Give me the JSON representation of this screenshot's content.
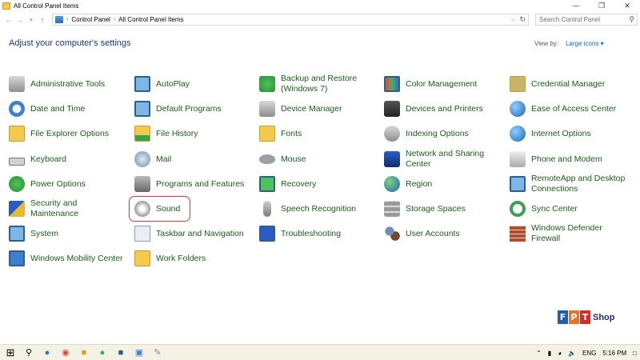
{
  "window": {
    "title": "All Control Panel Items"
  },
  "address_bar": {
    "breadcrumb": [
      "Control Panel",
      "All Control Panel Items"
    ],
    "search_placeholder": "Search Control Panel"
  },
  "header": {
    "heading": "Adjust your computer's settings",
    "view_by_label": "View by:",
    "view_by_value": "Large icons"
  },
  "items": [
    {
      "label": "Administrative Tools",
      "icon": "admin-tools-icon"
    },
    {
      "label": "AutoPlay",
      "icon": "autoplay-icon"
    },
    {
      "label": "Backup and Restore (Windows 7)",
      "icon": "backup-icon"
    },
    {
      "label": "Color Management",
      "icon": "color-management-icon"
    },
    {
      "label": "Credential Manager",
      "icon": "credential-icon"
    },
    {
      "label": "Date and Time",
      "icon": "clock-icon"
    },
    {
      "label": "Default Programs",
      "icon": "default-programs-icon"
    },
    {
      "label": "Device Manager",
      "icon": "device-manager-icon"
    },
    {
      "label": "Devices and Printers",
      "icon": "printer-icon"
    },
    {
      "label": "Ease of Access Center",
      "icon": "ease-of-access-icon"
    },
    {
      "label": "File Explorer Options",
      "icon": "folder-options-icon"
    },
    {
      "label": "File History",
      "icon": "file-history-icon"
    },
    {
      "label": "Fonts",
      "icon": "fonts-icon"
    },
    {
      "label": "Indexing Options",
      "icon": "indexing-icon"
    },
    {
      "label": "Internet Options",
      "icon": "internet-icon"
    },
    {
      "label": "Keyboard",
      "icon": "keyboard-icon"
    },
    {
      "label": "Mail",
      "icon": "mail-icon"
    },
    {
      "label": "Mouse",
      "icon": "mouse-icon"
    },
    {
      "label": "Network and Sharing Center",
      "icon": "network-icon"
    },
    {
      "label": "Phone and Modem",
      "icon": "phone-icon"
    },
    {
      "label": "Power Options",
      "icon": "power-icon"
    },
    {
      "label": "Programs and Features",
      "icon": "programs-icon"
    },
    {
      "label": "Recovery",
      "icon": "recovery-icon"
    },
    {
      "label": "Region",
      "icon": "region-icon"
    },
    {
      "label": "RemoteApp and Desktop Connections",
      "icon": "remoteapp-icon"
    },
    {
      "label": "Security and Maintenance",
      "icon": "flag-icon"
    },
    {
      "label": "Sound",
      "icon": "speaker-icon"
    },
    {
      "label": "Speech Recognition",
      "icon": "microphone-icon"
    },
    {
      "label": "Storage Spaces",
      "icon": "storage-icon"
    },
    {
      "label": "Sync Center",
      "icon": "sync-icon"
    },
    {
      "label": "System",
      "icon": "system-icon"
    },
    {
      "label": "Taskbar and Navigation",
      "icon": "taskbar-icon"
    },
    {
      "label": "Troubleshooting",
      "icon": "troubleshooting-icon"
    },
    {
      "label": "User Accounts",
      "icon": "users-icon"
    },
    {
      "label": "Windows Defender Firewall",
      "icon": "firewall-icon"
    },
    {
      "label": "Windows Mobility Center",
      "icon": "mobility-icon"
    },
    {
      "label": "Work Folders",
      "icon": "work-folders-icon"
    }
  ],
  "highlighted_item": "Sound",
  "taskbar": {
    "apps": [
      "search-icon",
      "edge-icon",
      "chrome-icon",
      "file-explorer-icon",
      "spotify-icon",
      "word-icon",
      "control-panel-icon",
      "paint-icon"
    ],
    "language": "ENG",
    "clock": "5:16 PM"
  },
  "watermark": {
    "letters": [
      "F",
      "P",
      "T"
    ],
    "text": "Shop"
  },
  "colors": {
    "link_green": "#1a5c1a",
    "heading_blue": "#1e3287",
    "highlight_red": "#d93a3a"
  }
}
